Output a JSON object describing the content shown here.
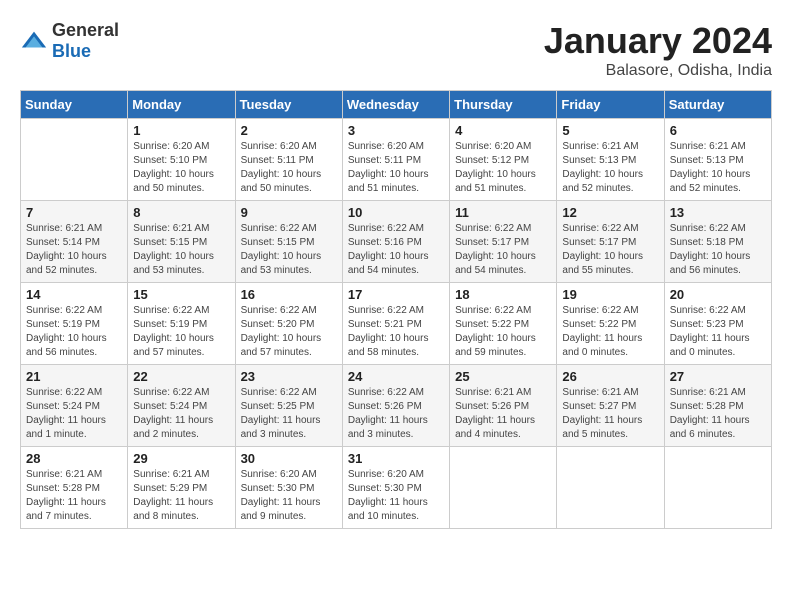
{
  "logo": {
    "text_general": "General",
    "text_blue": "Blue"
  },
  "header": {
    "month": "January 2024",
    "location": "Balasore, Odisha, India"
  },
  "weekdays": [
    "Sunday",
    "Monday",
    "Tuesday",
    "Wednesday",
    "Thursday",
    "Friday",
    "Saturday"
  ],
  "weeks": [
    [
      {
        "day": "",
        "info": ""
      },
      {
        "day": "1",
        "info": "Sunrise: 6:20 AM\nSunset: 5:10 PM\nDaylight: 10 hours\nand 50 minutes."
      },
      {
        "day": "2",
        "info": "Sunrise: 6:20 AM\nSunset: 5:11 PM\nDaylight: 10 hours\nand 50 minutes."
      },
      {
        "day": "3",
        "info": "Sunrise: 6:20 AM\nSunset: 5:11 PM\nDaylight: 10 hours\nand 51 minutes."
      },
      {
        "day": "4",
        "info": "Sunrise: 6:20 AM\nSunset: 5:12 PM\nDaylight: 10 hours\nand 51 minutes."
      },
      {
        "day": "5",
        "info": "Sunrise: 6:21 AM\nSunset: 5:13 PM\nDaylight: 10 hours\nand 52 minutes."
      },
      {
        "day": "6",
        "info": "Sunrise: 6:21 AM\nSunset: 5:13 PM\nDaylight: 10 hours\nand 52 minutes."
      }
    ],
    [
      {
        "day": "7",
        "info": "Sunrise: 6:21 AM\nSunset: 5:14 PM\nDaylight: 10 hours\nand 52 minutes."
      },
      {
        "day": "8",
        "info": "Sunrise: 6:21 AM\nSunset: 5:15 PM\nDaylight: 10 hours\nand 53 minutes."
      },
      {
        "day": "9",
        "info": "Sunrise: 6:22 AM\nSunset: 5:15 PM\nDaylight: 10 hours\nand 53 minutes."
      },
      {
        "day": "10",
        "info": "Sunrise: 6:22 AM\nSunset: 5:16 PM\nDaylight: 10 hours\nand 54 minutes."
      },
      {
        "day": "11",
        "info": "Sunrise: 6:22 AM\nSunset: 5:17 PM\nDaylight: 10 hours\nand 54 minutes."
      },
      {
        "day": "12",
        "info": "Sunrise: 6:22 AM\nSunset: 5:17 PM\nDaylight: 10 hours\nand 55 minutes."
      },
      {
        "day": "13",
        "info": "Sunrise: 6:22 AM\nSunset: 5:18 PM\nDaylight: 10 hours\nand 56 minutes."
      }
    ],
    [
      {
        "day": "14",
        "info": "Sunrise: 6:22 AM\nSunset: 5:19 PM\nDaylight: 10 hours\nand 56 minutes."
      },
      {
        "day": "15",
        "info": "Sunrise: 6:22 AM\nSunset: 5:19 PM\nDaylight: 10 hours\nand 57 minutes."
      },
      {
        "day": "16",
        "info": "Sunrise: 6:22 AM\nSunset: 5:20 PM\nDaylight: 10 hours\nand 57 minutes."
      },
      {
        "day": "17",
        "info": "Sunrise: 6:22 AM\nSunset: 5:21 PM\nDaylight: 10 hours\nand 58 minutes."
      },
      {
        "day": "18",
        "info": "Sunrise: 6:22 AM\nSunset: 5:22 PM\nDaylight: 10 hours\nand 59 minutes."
      },
      {
        "day": "19",
        "info": "Sunrise: 6:22 AM\nSunset: 5:22 PM\nDaylight: 11 hours\nand 0 minutes."
      },
      {
        "day": "20",
        "info": "Sunrise: 6:22 AM\nSunset: 5:23 PM\nDaylight: 11 hours\nand 0 minutes."
      }
    ],
    [
      {
        "day": "21",
        "info": "Sunrise: 6:22 AM\nSunset: 5:24 PM\nDaylight: 11 hours\nand 1 minute."
      },
      {
        "day": "22",
        "info": "Sunrise: 6:22 AM\nSunset: 5:24 PM\nDaylight: 11 hours\nand 2 minutes."
      },
      {
        "day": "23",
        "info": "Sunrise: 6:22 AM\nSunset: 5:25 PM\nDaylight: 11 hours\nand 3 minutes."
      },
      {
        "day": "24",
        "info": "Sunrise: 6:22 AM\nSunset: 5:26 PM\nDaylight: 11 hours\nand 3 minutes."
      },
      {
        "day": "25",
        "info": "Sunrise: 6:21 AM\nSunset: 5:26 PM\nDaylight: 11 hours\nand 4 minutes."
      },
      {
        "day": "26",
        "info": "Sunrise: 6:21 AM\nSunset: 5:27 PM\nDaylight: 11 hours\nand 5 minutes."
      },
      {
        "day": "27",
        "info": "Sunrise: 6:21 AM\nSunset: 5:28 PM\nDaylight: 11 hours\nand 6 minutes."
      }
    ],
    [
      {
        "day": "28",
        "info": "Sunrise: 6:21 AM\nSunset: 5:28 PM\nDaylight: 11 hours\nand 7 minutes."
      },
      {
        "day": "29",
        "info": "Sunrise: 6:21 AM\nSunset: 5:29 PM\nDaylight: 11 hours\nand 8 minutes."
      },
      {
        "day": "30",
        "info": "Sunrise: 6:20 AM\nSunset: 5:30 PM\nDaylight: 11 hours\nand 9 minutes."
      },
      {
        "day": "31",
        "info": "Sunrise: 6:20 AM\nSunset: 5:30 PM\nDaylight: 11 hours\nand 10 minutes."
      },
      {
        "day": "",
        "info": ""
      },
      {
        "day": "",
        "info": ""
      },
      {
        "day": "",
        "info": ""
      }
    ]
  ]
}
